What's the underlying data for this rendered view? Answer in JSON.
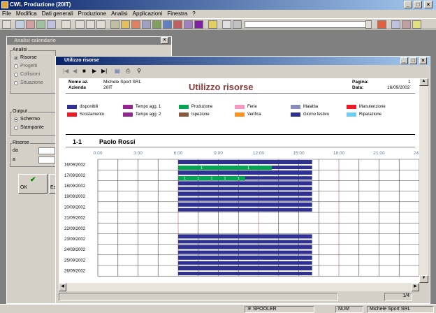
{
  "app": {
    "title": "CWL Produzione (20IT)"
  },
  "menu": [
    "File",
    "Modifica",
    "Dati generali",
    "Produzione",
    "Analisi",
    "Applicazioni",
    "Finestra",
    "?"
  ],
  "side": {
    "title": "Analisi calendario",
    "analisi_label": "Analisi",
    "analisi_options": [
      "Risorse",
      "Progetti",
      "Collisioni",
      "Situazione"
    ],
    "output_label": "Output",
    "output_options": [
      "Schermo",
      "Stampante"
    ],
    "risorse_label": "Risorse",
    "da_label": "da",
    "a_label": "a",
    "ok_label": "OK",
    "es_label": "Es"
  },
  "window": {
    "title": "Utilizzo risorse"
  },
  "report": {
    "nome_label": "Nome az.",
    "nome_value": "Michele Sport SRL",
    "azienda_label": "Azienda",
    "azienda_value": "20IT",
    "title": "Utilizzo risorse",
    "pagina_label": "Pagina:",
    "pagina_value": "1",
    "data_label": "Data:",
    "data_value": "16/09/2002",
    "legend": [
      {
        "label": "disponibili",
        "color": "#2e3192"
      },
      {
        "label": "Scostamento",
        "color": "#ed1c24"
      },
      {
        "label": "Tempo agg. 1",
        "color": "#93278f"
      },
      {
        "label": "Tempo agg. 2",
        "color": "#92278f"
      },
      {
        "label": "Produzione",
        "color": "#00a651"
      },
      {
        "label": "Ispezione",
        "color": "#8b5a3c"
      },
      {
        "label": "Ferie",
        "color": "#f49ac1"
      },
      {
        "label": "Verifica",
        "color": "#f7941d"
      },
      {
        "label": "Malattia",
        "color": "#8c8cba"
      },
      {
        "label": "Giorno festivo",
        "color": "#2e3192"
      },
      {
        "label": "Manutenzione",
        "color": "#ed1c24"
      },
      {
        "label": "Riparazione",
        "color": "#6dcff6"
      }
    ],
    "resource_code": "1-1",
    "resource_name": "Paolo Rossi",
    "hours": [
      "0:00",
      "3:00",
      "6:00",
      "9:00",
      "12:00",
      "15:00",
      "18:00",
      "21:00",
      "24:00"
    ],
    "rows": [
      {
        "date": "16/09/2002",
        "avail": [
          [
            6,
            16
          ]
        ],
        "prod": [
          [
            6,
            13
          ]
        ],
        "prod_labels": [
          "1",
          "1"
        ]
      },
      {
        "date": "17/09/2002",
        "avail": [
          [
            6,
            16
          ]
        ],
        "prod": [
          [
            6,
            11
          ]
        ],
        "prod_labels": [
          "1",
          "1",
          "1",
          "1",
          "1"
        ]
      },
      {
        "date": "18/09/2002",
        "avail": [
          [
            6,
            16
          ]
        ],
        "prod": [],
        "prod_labels": []
      },
      {
        "date": "19/09/2002",
        "avail": [
          [
            6,
            16
          ]
        ],
        "prod": [],
        "prod_labels": []
      },
      {
        "date": "20/09/2002",
        "avail": [
          [
            6,
            16
          ]
        ],
        "prod": [],
        "prod_labels": []
      },
      {
        "date": "21/09/2002",
        "avail": [],
        "prod": [],
        "prod_labels": []
      },
      {
        "date": "22/09/2002",
        "avail": [],
        "prod": [],
        "prod_labels": []
      },
      {
        "date": "23/09/2002",
        "avail": [
          [
            6,
            16
          ]
        ],
        "prod": [],
        "prod_labels": []
      },
      {
        "date": "24/09/2002",
        "avail": [
          [
            6,
            16
          ]
        ],
        "prod": [],
        "prod_labels": []
      },
      {
        "date": "25/09/2002",
        "avail": [
          [
            6,
            16
          ]
        ],
        "prod": [],
        "prod_labels": []
      },
      {
        "date": "26/09/2002",
        "avail": [
          [
            6,
            16
          ]
        ],
        "prod": [],
        "prod_labels": []
      }
    ],
    "page_indicator": "1/4"
  },
  "status": {
    "spooler": "SPOOLER",
    "num": "NUM",
    "company": "Michele Sport SRL"
  },
  "colors": {
    "available": "#2e3192",
    "production": "#00a651"
  }
}
